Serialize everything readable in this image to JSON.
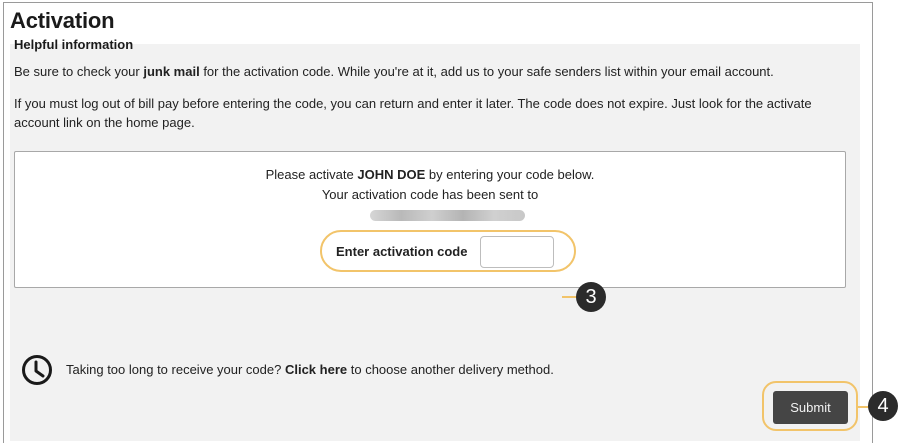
{
  "page": {
    "title": "Activation"
  },
  "help": {
    "heading": "Helpful information",
    "line1_a": "Be sure to check your ",
    "line1_bold": "junk mail",
    "line1_b": " for the activation code. While you're at it, add us to your safe senders list within your email account.",
    "line2": "If you must log out of bill pay before entering the code, you can return and enter it later. The code does not expire. Just look for the activate account link on the home page."
  },
  "activation": {
    "line1_a": "Please activate ",
    "user_name": "JOHN DOE",
    "line1_b": " by entering your code below.",
    "line2": "Your activation code has been sent to",
    "code_label": "Enter activation code",
    "code_value": ""
  },
  "delivery": {
    "text_a": "Taking too long to receive your code? ",
    "link": "Click here",
    "text_b": " to choose another delivery method."
  },
  "actions": {
    "submit_label": "Submit"
  },
  "callouts": {
    "code_step": "3",
    "submit_step": "4",
    "accent_color": "#f2c46a"
  }
}
